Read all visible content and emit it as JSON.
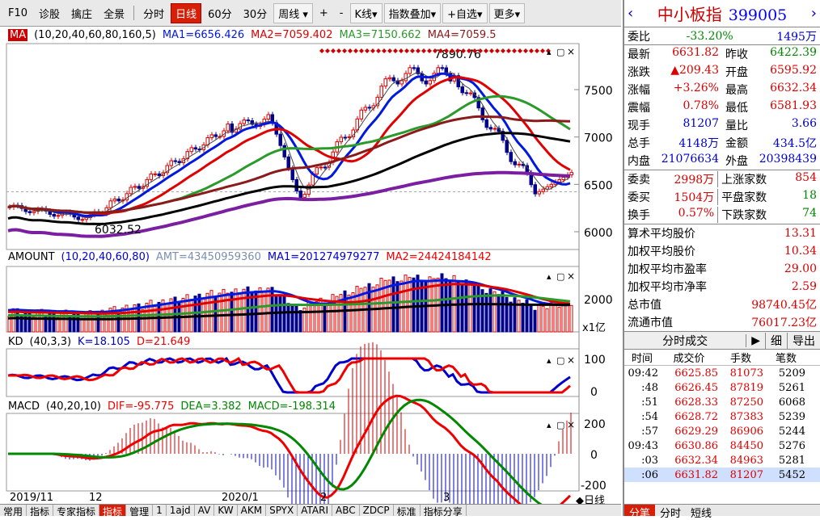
{
  "toolbar": {
    "f10": "F10",
    "items": [
      "诊股",
      "擒庄",
      "全景"
    ],
    "periods": [
      "分时",
      "日线",
      "60分",
      "30分"
    ],
    "active_period": "日线",
    "weekly": "周线",
    "plus": "+",
    "minus": "-",
    "kline": "K线",
    "overlay": "指数叠加",
    "fav": "+自选",
    "more": "更多"
  },
  "ma_panel": {
    "label": "MA",
    "params": "(10,20,40,60,80,160,5)",
    "ma1": "MA1=6656.426",
    "ma2": "MA2=7059.402",
    "ma3": "MA3=7150.662",
    "ma4": "MA4=7059.5",
    "high_label": "7890.76",
    "low_label": "6032.52",
    "yticks": [
      "7500",
      "7000",
      "6500",
      "6000"
    ]
  },
  "amount_panel": {
    "label": "AMOUNT",
    "params": "(10,20,40,60,80)",
    "amt": "AMT=43450959360",
    "ma1": "MA1=201274979277",
    "ma2": "MA2=24424184142",
    "ytick": "2000",
    "unit": "x1亿"
  },
  "kd_panel": {
    "label": "KD",
    "params": "(40,3,3)",
    "k": "K=18.105",
    "d": "D=21.649",
    "yticks": [
      "100",
      "0"
    ]
  },
  "macd_panel": {
    "label": "MACD",
    "params": "(40,20,10)",
    "dif": "DIF=-95.775",
    "dea": "DEA=3.382",
    "macd": "MACD=-198.314",
    "yticks": [
      "200",
      "0",
      "-200"
    ]
  },
  "xaxis": [
    "2019/11",
    "12",
    "2020/1",
    "2",
    "3"
  ],
  "xaxis_end": "◆日线",
  "bottombar": [
    "常用",
    "指标",
    "专家指标",
    "指标",
    "管理",
    "1",
    "1ajd",
    "AV",
    "KW",
    "AKM",
    "SPYX",
    "ATARI",
    "ABC",
    "ZDCP",
    "标准",
    "指标分享"
  ],
  "bottombar_active": 3,
  "right": {
    "name": "中小板指",
    "code": "399005",
    "weibi_l": "委比",
    "weibi_v": "-33.20%",
    "weibi_r": "1495万",
    "quotes": [
      [
        "最新",
        "6631.82",
        "昨收",
        "6422.39"
      ],
      [
        "涨跌",
        "▲209.43",
        "开盘",
        "6595.92"
      ],
      [
        "涨幅",
        "+3.26%",
        "最高",
        "6632.34"
      ],
      [
        "震幅",
        "0.78%",
        "最低",
        "6581.93"
      ],
      [
        "现手",
        "81207",
        "量比",
        "3.66"
      ],
      [
        "总手",
        "4148万",
        "金额",
        "434.5亿"
      ],
      [
        "内盘",
        "21076634",
        "外盘",
        "20398439"
      ]
    ],
    "counts": [
      [
        "委卖",
        "2998万",
        "上涨家数",
        "854"
      ],
      [
        "委买",
        "1504万",
        "平盘家数",
        "18"
      ],
      [
        "换手",
        "0.57%",
        "下跌家数",
        "74"
      ]
    ],
    "stats": [
      [
        "算术平均股价",
        "13.31"
      ],
      [
        "加权平均股价",
        "10.34"
      ],
      [
        "加权平均市盈率",
        "29.00"
      ],
      [
        "加权平均市净率",
        "2.59"
      ],
      [
        "总市值",
        "98740.45亿"
      ],
      [
        "流通市值",
        "76017.23亿"
      ]
    ],
    "trade_title": "分时成交",
    "trade_btn1": "细",
    "trade_btn2": "导出",
    "cols": [
      "时间",
      "成交价",
      "手数",
      "笔数"
    ],
    "trades": [
      [
        "09:42",
        "6625.85",
        "81073",
        "5209"
      ],
      [
        ":48",
        "6626.45",
        "87819",
        "5261"
      ],
      [
        ":51",
        "6628.33",
        "87250",
        "6068"
      ],
      [
        ":54",
        "6628.72",
        "87383",
        "5239"
      ],
      [
        ":57",
        "6629.29",
        "86906",
        "5244"
      ],
      [
        "09:43",
        "6630.86",
        "84450",
        "5276"
      ],
      [
        ":03",
        "6632.34",
        "84963",
        "5281"
      ],
      [
        ":06",
        "6631.82",
        "81207",
        "5452"
      ]
    ],
    "tabs": [
      "分笔",
      "分时",
      "短线"
    ]
  },
  "colors": {
    "up": "#d00",
    "down": "#00008b",
    "ma1": "#0018e0",
    "ma2": "#e00000",
    "ma3": "#2a9a2a",
    "ma4": "#8b1a1a",
    "ma5": "#000",
    "ma6": "#7b1fa2",
    "accent": "#d81e06"
  }
}
